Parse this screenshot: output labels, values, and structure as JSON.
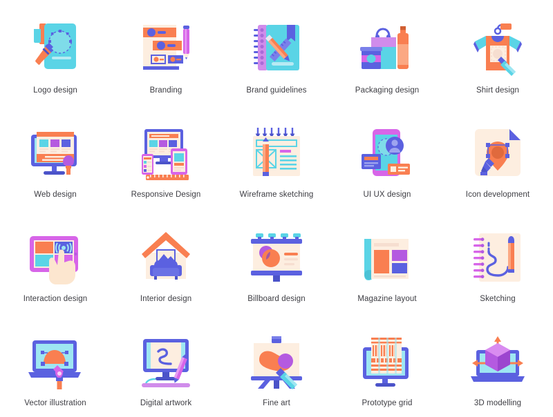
{
  "page": {
    "title": "Graphic design flat icon set",
    "background": "#ffffff",
    "columns": 5,
    "rows": 4
  },
  "palette": {
    "cyan": "#5ad4e6",
    "cyan_light": "#9ee6f2",
    "cyan_pale": "#c8f0f7",
    "orange": "#f97f51",
    "orange_light": "#fba883",
    "blue": "#5b61e0",
    "blue_light": "#7a80ea",
    "indigo": "#4b53c9",
    "purple": "#b45ae0",
    "purple_light": "#d08ceb",
    "magenta": "#d765e8",
    "cream": "#fdeee0",
    "cream_dark": "#f6ded0",
    "skin": "#fce6cf",
    "text": "#3c3c42"
  },
  "icons": [
    {
      "id": "logo-design",
      "label": "Logo design",
      "icon_name": "logo-design-icon",
      "row": 1,
      "col": 1,
      "elements": [
        "document",
        "magnifier-anchor-points",
        "pen-nib",
        "orange-bookmark"
      ],
      "colors": [
        "#5ad4e6",
        "#f97f51",
        "#5b61e0"
      ]
    },
    {
      "id": "branding",
      "label": "Branding",
      "icon_name": "branding-icon",
      "row": 1,
      "col": 2,
      "elements": [
        "paper-sheet",
        "orange-bars",
        "blue-dots",
        "purple-pencil"
      ],
      "colors": [
        "#fdeee0",
        "#f97f51",
        "#5b61e0",
        "#d765e8"
      ]
    },
    {
      "id": "brand-guidelines",
      "label": "Brand guidelines",
      "icon_name": "brand-guidelines-icon",
      "row": 1,
      "col": 3,
      "elements": [
        "spiral-notebook",
        "ruler",
        "pencil",
        "bookmark"
      ],
      "colors": [
        "#5ad4e6",
        "#b45ae0",
        "#f97f51",
        "#5b61e0"
      ]
    },
    {
      "id": "packaging-design",
      "label": "Packaging design",
      "icon_name": "packaging-design-icon",
      "row": 1,
      "col": 4,
      "elements": [
        "shopping-bag",
        "bottle",
        "jar-can"
      ],
      "colors": [
        "#5ad4e6",
        "#b45ae0",
        "#f97f51",
        "#5b61e0"
      ]
    },
    {
      "id": "shirt-design",
      "label": "Shirt design",
      "icon_name": "shirt-design-icon",
      "row": 1,
      "col": 5,
      "elements": [
        "t-shirt",
        "hanger",
        "tag",
        "paint-brush"
      ],
      "colors": [
        "#f97f51",
        "#5ad4e6",
        "#5b61e0"
      ]
    },
    {
      "id": "web-design",
      "label": "Web design",
      "icon_name": "web-design-icon",
      "row": 2,
      "col": 1,
      "elements": [
        "desktop-monitor",
        "webpage-layout",
        "paint-brush"
      ],
      "colors": [
        "#5b61e0",
        "#f97f51",
        "#5ad4e6",
        "#b45ae0"
      ]
    },
    {
      "id": "responsive-design",
      "label": "Responsive Design",
      "icon_name": "responsive-design-icon",
      "row": 2,
      "col": 2,
      "elements": [
        "monitor",
        "tablet",
        "phone",
        "ruler"
      ],
      "colors": [
        "#5b61e0",
        "#d765e8",
        "#f97f51",
        "#5ad4e6"
      ]
    },
    {
      "id": "wireframe-sketching",
      "label": "Wireframe sketching",
      "icon_name": "wireframe-sketching-icon",
      "row": 2,
      "col": 3,
      "elements": [
        "spiral-pad",
        "wireframe-box",
        "text-lines",
        "pencil"
      ],
      "colors": [
        "#fdeee0",
        "#5ad4e6",
        "#f97f51",
        "#5b61e0",
        "#d765e8"
      ]
    },
    {
      "id": "ui-ux-design",
      "label": "UI UX design",
      "icon_name": "ui-ux-design-icon",
      "row": 2,
      "col": 4,
      "elements": [
        "smartphone",
        "avatar-circle",
        "blue-card",
        "orange-card"
      ],
      "colors": [
        "#d765e8",
        "#5ad4e6",
        "#5b61e0",
        "#f97f51"
      ]
    },
    {
      "id": "icon-development",
      "label": "Icon development",
      "icon_name": "icon-development-icon",
      "row": 2,
      "col": 5,
      "elements": [
        "rounded-canvas",
        "location-pin",
        "pen-nib",
        "folded-corner"
      ],
      "colors": [
        "#fdeee0",
        "#f97f51",
        "#5b61e0"
      ]
    },
    {
      "id": "interaction-design",
      "label": "Interaction design",
      "icon_name": "interaction-design-icon",
      "row": 3,
      "col": 1,
      "elements": [
        "tablet-frame",
        "tile-grid",
        "tap-ripple",
        "hand-pointer"
      ],
      "colors": [
        "#d765e8",
        "#f97f51",
        "#5ad4e6",
        "#5b61e0",
        "#fce6cf"
      ]
    },
    {
      "id": "interior-design",
      "label": "Interior design",
      "icon_name": "interior-design-icon",
      "row": 3,
      "col": 2,
      "elements": [
        "house-roof",
        "sofa",
        "framed-picture"
      ],
      "colors": [
        "#f97f51",
        "#5b61e0",
        "#fdeee0"
      ]
    },
    {
      "id": "billboard-design",
      "label": "Billboard design",
      "icon_name": "billboard-design-icon",
      "row": 3,
      "col": 3,
      "elements": [
        "billboard-board",
        "lamps",
        "circles-overlap",
        "text-lines",
        "stand"
      ],
      "colors": [
        "#5b61e0",
        "#5ad4e6",
        "#b45ae0",
        "#f97f51",
        "#fdeee0"
      ]
    },
    {
      "id": "magazine-layout",
      "label": "Magazine layout",
      "icon_name": "magazine-layout-icon",
      "row": 3,
      "col": 4,
      "elements": [
        "magazine-page",
        "curled-edge",
        "image-blocks",
        "text-lines"
      ],
      "colors": [
        "#5ad4e6",
        "#fdeee0",
        "#f97f51",
        "#b45ae0",
        "#5b61e0"
      ]
    },
    {
      "id": "sketching",
      "label": "Sketching",
      "icon_name": "sketching-icon",
      "row": 3,
      "col": 5,
      "elements": [
        "spiral-notebook",
        "squiggle-line",
        "pencil"
      ],
      "colors": [
        "#fdeee0",
        "#5b61e0",
        "#f97f51",
        "#d765e8"
      ]
    },
    {
      "id": "vector-illustration",
      "label": "Vector illustration",
      "icon_name": "vector-illustration-icon",
      "row": 4,
      "col": 1,
      "elements": [
        "laptop",
        "bezier-shape",
        "anchor-handles",
        "pen-nib"
      ],
      "colors": [
        "#5b61e0",
        "#5ad4e6",
        "#f97f51",
        "#d765e8"
      ]
    },
    {
      "id": "digital-artwork",
      "label": "Digital artwork",
      "icon_name": "digital-artwork-icon",
      "row": 4,
      "col": 2,
      "elements": [
        "monitor",
        "drawn-squiggle",
        "stylus-pen",
        "cable"
      ],
      "colors": [
        "#5b61e0",
        "#5ad4e6",
        "#fdeee0",
        "#d765e8"
      ]
    },
    {
      "id": "fine-art",
      "label": "Fine art",
      "icon_name": "fine-art-icon",
      "row": 4,
      "col": 3,
      "elements": [
        "easel",
        "canvas",
        "orange-blob",
        "purple-circle",
        "paint-brush"
      ],
      "colors": [
        "#5b61e0",
        "#fdeee0",
        "#f97f51",
        "#b45ae0",
        "#5ad4e6"
      ]
    },
    {
      "id": "prototype-grid",
      "label": "Prototype grid",
      "icon_name": "prototype-grid-icon",
      "row": 4,
      "col": 4,
      "elements": [
        "monitor",
        "wireframe-grid-sheet"
      ],
      "colors": [
        "#5b61e0",
        "#5ad4e6",
        "#f97f51",
        "#fdeee0"
      ]
    },
    {
      "id": "3d-modelling",
      "label": "3D modelling",
      "icon_name": "3d-modelling-icon",
      "row": 4,
      "col": 5,
      "elements": [
        "laptop",
        "3d-cube",
        "axis-arrows"
      ],
      "colors": [
        "#5b61e0",
        "#5ad4e6",
        "#b45ae0",
        "#f97f51"
      ]
    }
  ]
}
